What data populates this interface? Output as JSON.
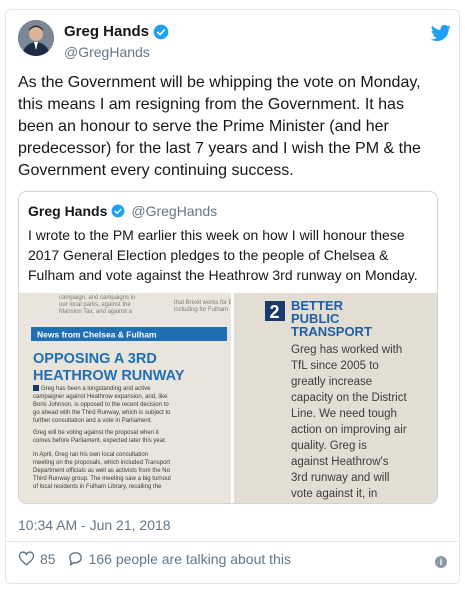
{
  "tweet": {
    "author_name": "Greg Hands",
    "author_handle": "@GregHands",
    "text": "As the Government will be whipping the vote on Monday, this means I am resigning from the Government. It has been an honour to serve the Prime Minister (and her predecessor) for the last 7 years and I wish the PM & the Government every continuing success.",
    "timestamp": "10:34 AM - Jun 21, 2018",
    "likes": "85",
    "talking": "166 people are talking about this"
  },
  "quoted": {
    "author_name": "Greg Hands",
    "author_handle": "@GregHands",
    "text": "I wrote to the PM earlier this week on how I will honour these 2017 General Election pledges to the people of Chelsea & Fulham and vote against the Heathrow 3rd runway on Monday.",
    "image": {
      "left_top_snippet": [
        "campaign, and campaigns in",
        "our local parks, against the",
        "Mansion Tax, and against a"
      ],
      "left_top_snippet_right": [
        "that Brexit works for Bri",
        "including for Fulham"
      ],
      "banner": "News from Chelsea & Fulham",
      "headline_line1": "OPPOSING A 3RD",
      "headline_line2": "HEATHROW RUNWAY",
      "para1": [
        "Greg has been a longstanding and active",
        "campaigner against Heathrow expansion, and, like",
        "Boris Johnson, is opposed to the recent decision to",
        "go ahead with the Third Runway, which is subject to",
        "further consultation and a vote in Parliament."
      ],
      "para2": [
        "Greg will be voting against the proposal when it",
        "comes before Parliament, expected later this year."
      ],
      "para3": [
        "In April, Greg ran his own local consultation",
        "meeting on the proposals, which included Transport",
        "Department officials as well as activists from the No",
        "Third Runway group. The meeting saw a big turnout",
        "of local residents in Fulham Library, recalling the"
      ],
      "right_number": "2",
      "right_title": [
        "BETTER",
        "PUBLIC",
        "TRANSPORT"
      ],
      "right_text": [
        "Greg has worked with",
        "TfL since 2005 to",
        "greatly increase",
        "capacity on the District",
        "Line. We need tough",
        "action on improving air",
        "quality. Greg  is",
        "against Heathrow's",
        "3rd runway and will",
        "vote against it, in"
      ],
      "colors": {
        "navy": "#1b3a6b",
        "blue": "#1f6fb5",
        "paper": "#e8e4dc"
      }
    }
  },
  "icons": {
    "verified": "verified-badge-icon",
    "bird": "twitter-bird-icon",
    "heart": "heart-icon",
    "comment": "comment-icon",
    "info": "info-icon"
  },
  "colors": {
    "twitter_blue": "#1da1f2",
    "muted": "#657786",
    "border": "#e1e8ed"
  }
}
